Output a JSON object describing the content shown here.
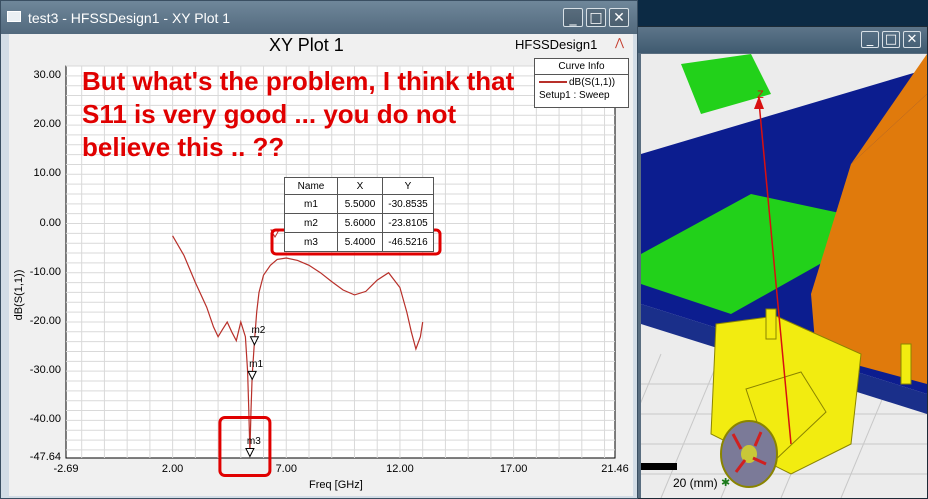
{
  "plot_window": {
    "title": "test3 - HFSSDesign1 - XY Plot 1",
    "buttons": {
      "minimize": "_",
      "maximize": "□",
      "close": "✕"
    }
  },
  "plot": {
    "title": "XY Plot 1",
    "design": "HFSSDesign1",
    "annotation": "But what's the problem, I think that S11 is very good ... you do not believe this .. ??",
    "curve_info": {
      "header": "Curve Info",
      "trace": "dB(S(1,1))",
      "setup": "Setup1 : Sweep"
    },
    "marker_table": {
      "headers": [
        "Name",
        "X",
        "Y"
      ],
      "rows": [
        [
          "m1",
          "5.5000",
          "-30.8535"
        ],
        [
          "m2",
          "5.6000",
          "-23.8105"
        ],
        [
          "m3",
          "5.4000",
          "-46.5216"
        ]
      ]
    },
    "marker_labels": [
      "m1",
      "m2",
      "m3"
    ],
    "highlight_color": "#e00000",
    "trace_color": "#b8302a"
  },
  "chart_data": {
    "type": "line",
    "title": "XY Plot 1",
    "xlabel": "Freq [GHz]",
    "ylabel": "dB(S(1,1))",
    "xlim": [
      -2.69,
      21.46
    ],
    "ylim": [
      -47.64,
      32.0
    ],
    "x_ticks": [
      "-2.69",
      "2.00",
      "7.00",
      "12.00",
      "17.00",
      "21.46"
    ],
    "y_ticks": [
      "30.00",
      "20.00",
      "10.00",
      "0.00",
      "-10.00",
      "-20.00",
      "-30.00",
      "-40.00",
      "-47.64"
    ],
    "grid": true,
    "legend": "top-right",
    "series": [
      {
        "name": "dB(S(1,1))",
        "x": [
          2.0,
          2.5,
          3.0,
          3.5,
          3.8,
          4.0,
          4.2,
          4.4,
          4.6,
          4.8,
          5.0,
          5.2,
          5.3,
          5.35,
          5.4,
          5.45,
          5.5,
          5.6,
          5.7,
          5.8,
          6.0,
          6.3,
          6.6,
          7.0,
          7.5,
          8.0,
          8.5,
          9.0,
          9.5,
          10.0,
          10.5,
          11.0,
          11.5,
          12.0,
          12.3,
          12.5,
          12.7,
          12.9,
          13.0
        ],
        "y": [
          -2.5,
          -6.5,
          -12.0,
          -17.0,
          -21.0,
          -23.0,
          -21.5,
          -20.0,
          -22.0,
          -23.8,
          -20.0,
          -23.0,
          -30.0,
          -38.0,
          -46.5,
          -38.0,
          -30.85,
          -23.8,
          -18.0,
          -14.0,
          -10.5,
          -8.5,
          -7.3,
          -7.0,
          -7.5,
          -8.5,
          -10.0,
          -11.8,
          -13.5,
          -14.5,
          -13.8,
          -11.5,
          -10.0,
          -13.0,
          -18.0,
          -22.0,
          -25.5,
          -23.0,
          -20.0
        ]
      }
    ],
    "markers": [
      {
        "name": "m1",
        "x": 5.5,
        "y": -30.8535
      },
      {
        "name": "m2",
        "x": 5.6,
        "y": -23.8105
      },
      {
        "name": "m3",
        "x": 5.4,
        "y": -46.5216
      }
    ]
  },
  "model_window": {
    "buttons": {
      "minimize": "_",
      "maximize": "□",
      "close": "✕"
    },
    "axis_label": "Z",
    "scale_label": "20 (mm)"
  }
}
